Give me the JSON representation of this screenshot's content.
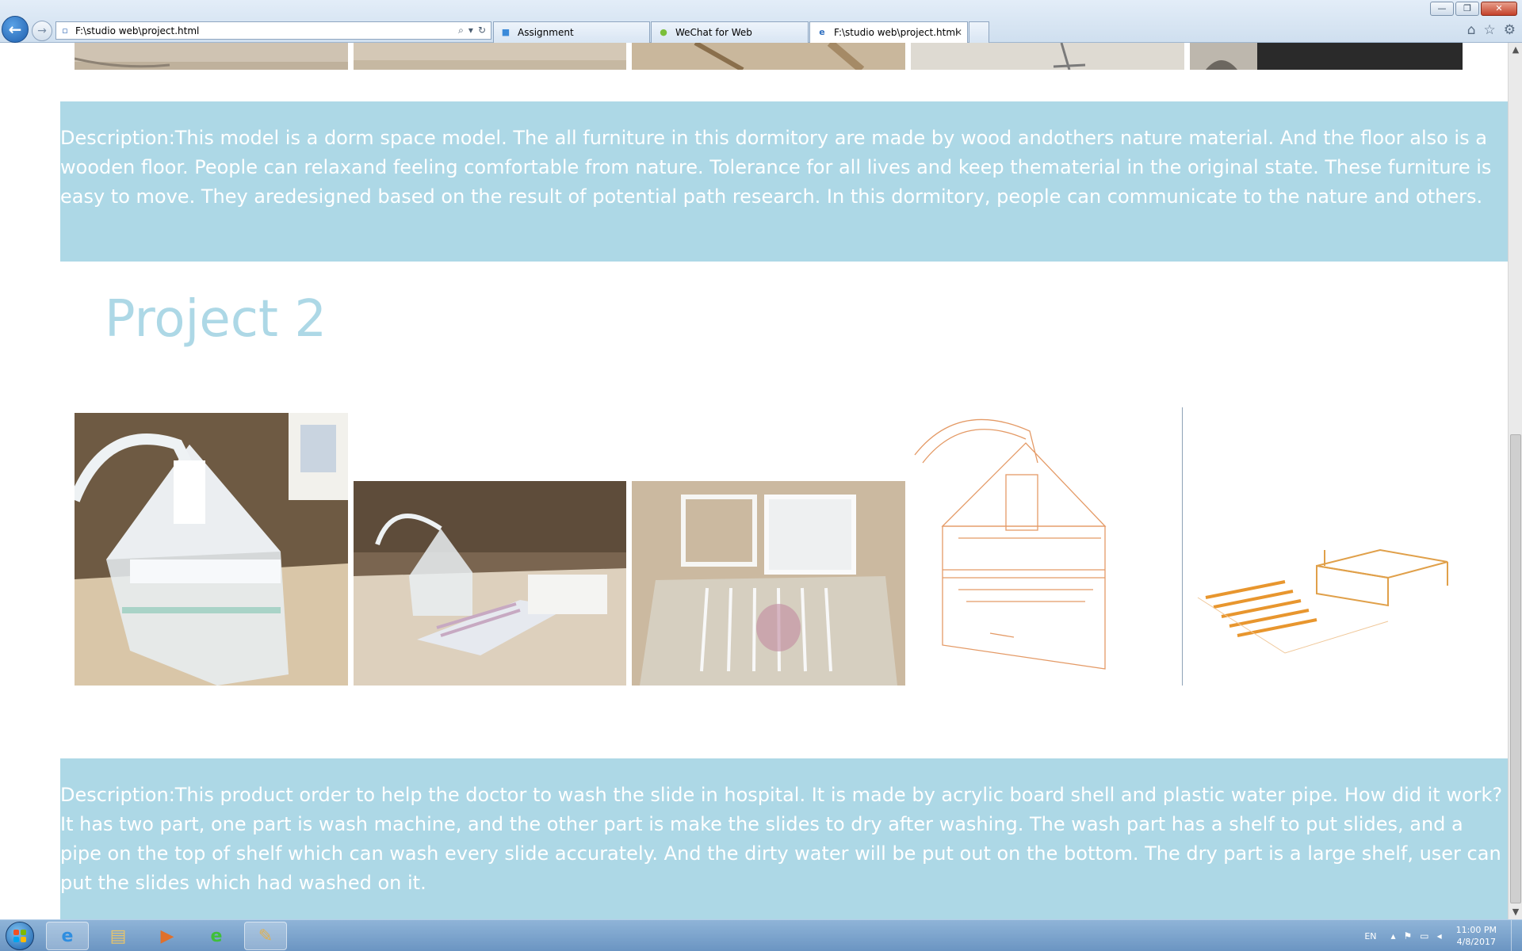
{
  "window": {
    "minimize_label": "—",
    "restore_label": "❐",
    "close_label": "✕"
  },
  "toolbar": {
    "back_icon": "←",
    "forward_icon": "→",
    "address": "F:\\studio web\\project.html",
    "address_icons": [
      "⌕",
      "▾",
      "↻"
    ]
  },
  "tabs": [
    {
      "label": "Assignment",
      "icon": "■",
      "icon_color": "#3b8ad9",
      "active": false
    },
    {
      "label": "WeChat for Web",
      "icon": "●",
      "icon_color": "#7bbf3a",
      "active": false
    },
    {
      "label": "F:\\studio web\\project.html",
      "icon": "e",
      "icon_color": "#2f6fc0",
      "active": true,
      "close": "✕"
    }
  ],
  "tools": [
    "⌂",
    "☆",
    "⚙"
  ],
  "page": {
    "project1_description": "Description:This model is a dorm space model. The all furniture in this dormitory are made by wood andothers nature material. And the floor also is a wooden floor. People can relaxand feeling comfortable from nature. Tolerance for all lives and keep thematerial in the original state. These furniture is easy to move. They aredesigned based on the result of potential path research. In this dormitory, people can communicate to the nature and others.",
    "project2_title": "Project 2",
    "project2_description": "Description:This product order to help the doctor to wash the slide in hospital. It is made by acrylic board shell and plastic water pipe. How did it work? It has two part, one part is wash machine, and the other part is make the slides to dry after washing. The wash part has a shelf to put slides, and a pipe on the top of shelf which can wash every slide accurately. And the dirty water will be put out on the bottom. The dry part is a large shelf, user can put the slides which had washed on it.",
    "accent_color": "#add8e6"
  },
  "scrollbar": {
    "up_icon": "▲",
    "down_icon": "▼"
  },
  "taskbar": {
    "apps": [
      {
        "name": "internet-explorer",
        "glyph": "e",
        "color": "#2f8ee0"
      },
      {
        "name": "file-explorer",
        "glyph": "▤",
        "color": "#e8c46a"
      },
      {
        "name": "media-player",
        "glyph": "▶",
        "color": "#e0702b"
      },
      {
        "name": "browser-green",
        "glyph": "e",
        "color": "#3fbf3a"
      },
      {
        "name": "paint",
        "glyph": "✎",
        "color": "#e0b050"
      }
    ],
    "language": "EN",
    "tray_icons": [
      "▴",
      "⚑",
      "▭",
      "◂"
    ],
    "time": "11:00 PM",
    "date": "4/8/2017"
  }
}
